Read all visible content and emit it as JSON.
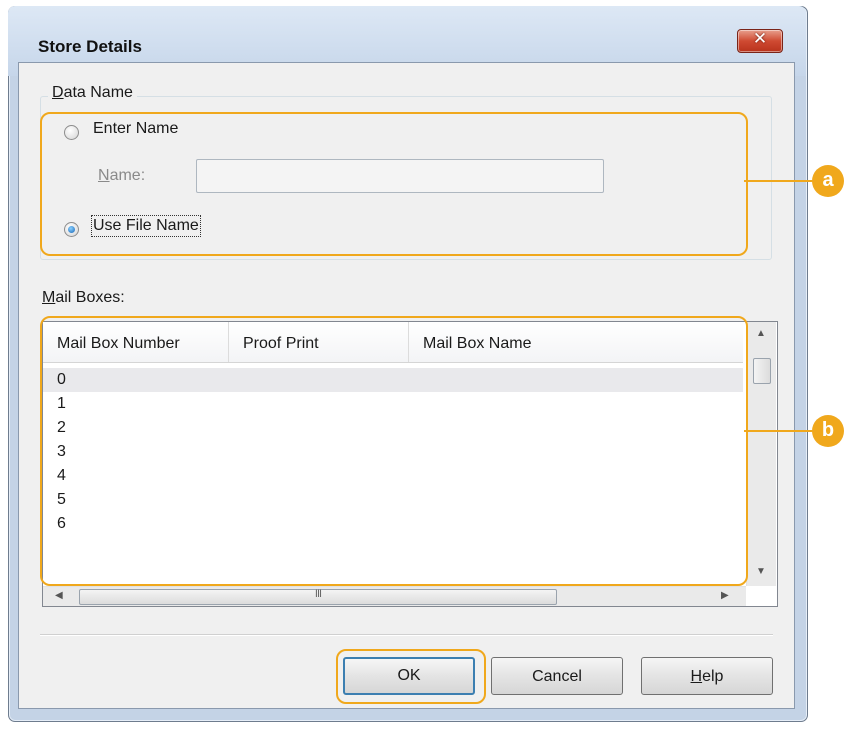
{
  "dialog": {
    "title": "Store Details"
  },
  "data_name_group": {
    "legend": "Data Name",
    "enter_name_label": "Enter Name",
    "enter_name_checked": false,
    "name_label": "Name:",
    "name_value": "",
    "use_file_name_label": "Use File Name",
    "use_file_name_checked": true
  },
  "mail_boxes": {
    "label": "Mail Boxes:",
    "columns": [
      "Mail Box Number",
      "Proof Print",
      "Mail Box Name"
    ],
    "rows": [
      {
        "number": "0",
        "proof_print": "",
        "name": "",
        "selected": true
      },
      {
        "number": "1",
        "proof_print": "",
        "name": "",
        "selected": false
      },
      {
        "number": "2",
        "proof_print": "",
        "name": "",
        "selected": false
      },
      {
        "number": "3",
        "proof_print": "",
        "name": "",
        "selected": false
      },
      {
        "number": "4",
        "proof_print": "",
        "name": "",
        "selected": false
      },
      {
        "number": "5",
        "proof_print": "",
        "name": "",
        "selected": false
      },
      {
        "number": "6",
        "proof_print": "",
        "name": "",
        "selected": false
      }
    ],
    "hscroll_grip": "III"
  },
  "buttons": {
    "ok": "OK",
    "cancel": "Cancel",
    "help": "Help"
  },
  "callouts": {
    "a": "a",
    "b": "b"
  },
  "colors": {
    "highlight": "#f0a81c",
    "title_bar": "#c6d6ea",
    "close_button": "#cf4a32"
  }
}
